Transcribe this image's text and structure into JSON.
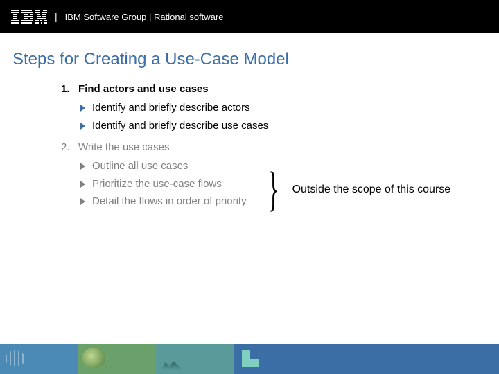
{
  "header": {
    "logo_alt": "IBM",
    "text": "IBM Software Group | Rational software"
  },
  "title": "Steps for Creating a Use-Case Model",
  "steps": [
    {
      "num": "1.",
      "label": "Find actors and use cases",
      "bold": true,
      "gray": false,
      "subs": [
        "Identify and briefly describe actors",
        "Identify and briefly describe use cases"
      ]
    },
    {
      "num": "2.",
      "label": "Write the use cases",
      "bold": false,
      "gray": true,
      "subs": [
        "Outline all use cases",
        "Prioritize the use-case flows",
        "Detail the flows in order of priority"
      ]
    }
  ],
  "annotation": "Outside the scope of this course"
}
